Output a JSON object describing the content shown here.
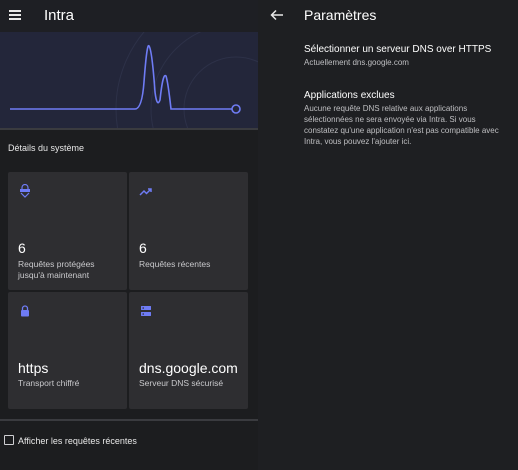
{
  "left_panel": {
    "app_title": "Intra",
    "section_title": "Détails du système",
    "cards": [
      {
        "icon": "shield-lock-icon",
        "value": "6",
        "label": "Requêtes protégées jusqu'à maintenant"
      },
      {
        "icon": "trending-up-icon",
        "value": "6",
        "label": "Requêtes récentes"
      },
      {
        "icon": "lock-icon",
        "value": "https",
        "label": "Transport chiffré"
      },
      {
        "icon": "dns-server-icon",
        "value": "dns.google.com",
        "label": "Serveur DNS sécurisé"
      }
    ],
    "show_recent_label": "Afficher les requêtes récentes",
    "show_recent_checked": false
  },
  "right_panel": {
    "title": "Paramètres",
    "prefs": [
      {
        "title": "Sélectionner un serveur DNS over HTTPS",
        "subtitle": "Actuellement dns.google.com"
      },
      {
        "title": "Applications exclues",
        "subtitle": "Aucune requête DNS relative aux applications sélectionnées ne sera envoyée via Intra. Si vous constatez qu'une application n'est pas compatible avec Intra, vous pouvez l'ajouter ici."
      }
    ]
  },
  "colors": {
    "accent": "#6f7cf5",
    "card_bg": "#2e2e31",
    "hero_bg": "#23263a"
  }
}
